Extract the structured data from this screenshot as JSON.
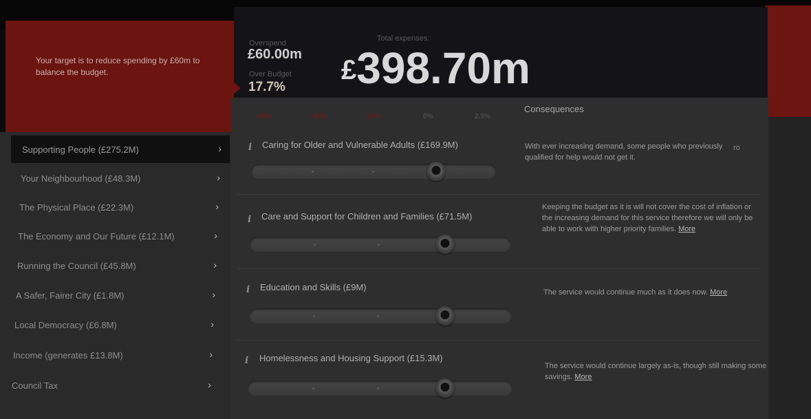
{
  "header": {
    "target_text": "Your target is to reduce spending by £60m to balance the budget.",
    "overspend_label": "Overspend",
    "overspend_value": "£60.00m",
    "over_budget_label": "Over Budget",
    "over_budget_value": "17.7%",
    "total_label": "Total expenses:",
    "total_symbol": "£",
    "total_value": "398.70m"
  },
  "scale": {
    "ticks": [
      "-40%",
      "-25%",
      "-10%",
      "0%",
      "2.5%"
    ],
    "consequences_heading": "Consequences"
  },
  "sidebar": {
    "items": [
      {
        "label": "Supporting People (£275.2M)",
        "active": true
      },
      {
        "label": "Your Neighbourhood (£48.3M)"
      },
      {
        "label": "The Physical Place (£22.3M)"
      },
      {
        "label": "The Economy and Our Future (£12.1M)"
      },
      {
        "label": "Running the Council (£45.8M)"
      },
      {
        "label": "A Safer, Fairer City (£1.8M)"
      },
      {
        "label": "Local Democracy (£6.8M)"
      },
      {
        "label": "Income (generates £13.8M)"
      },
      {
        "label": "Council Tax"
      }
    ],
    "chevron": "›"
  },
  "services": [
    {
      "title": "Caring for Older and Vulnerable Adults (£169.9M)",
      "consequence": "With ever increasing demand, some people who previously qualified for help would not get it.",
      "more": "",
      "slider_level_percent": 0
    },
    {
      "title": "Care and Support for Children and Families (£71.5M)",
      "consequence": "Keeping the budget as it is will not cover the cost of inflation or the increasing demand for this service therefore we will only be able to work with higher priority families.",
      "more": "More",
      "slider_level_percent": 0
    },
    {
      "title": "Education and Skills (£9M)",
      "consequence": "The service would continue much as it does now.",
      "more": "More",
      "slider_level_percent": 0
    },
    {
      "title": "Homelessness and Housing Support (£15.3M)",
      "consequence": "The service would continue largely as-is, though still making some savings.",
      "more": "More",
      "slider_level_percent": 0
    }
  ],
  "info_glyph": "i",
  "stray_text": "ro",
  "colors": {
    "accent_red": "#6b1410",
    "negative_scale": "#6a1c17",
    "panel_dark": "#141418"
  }
}
